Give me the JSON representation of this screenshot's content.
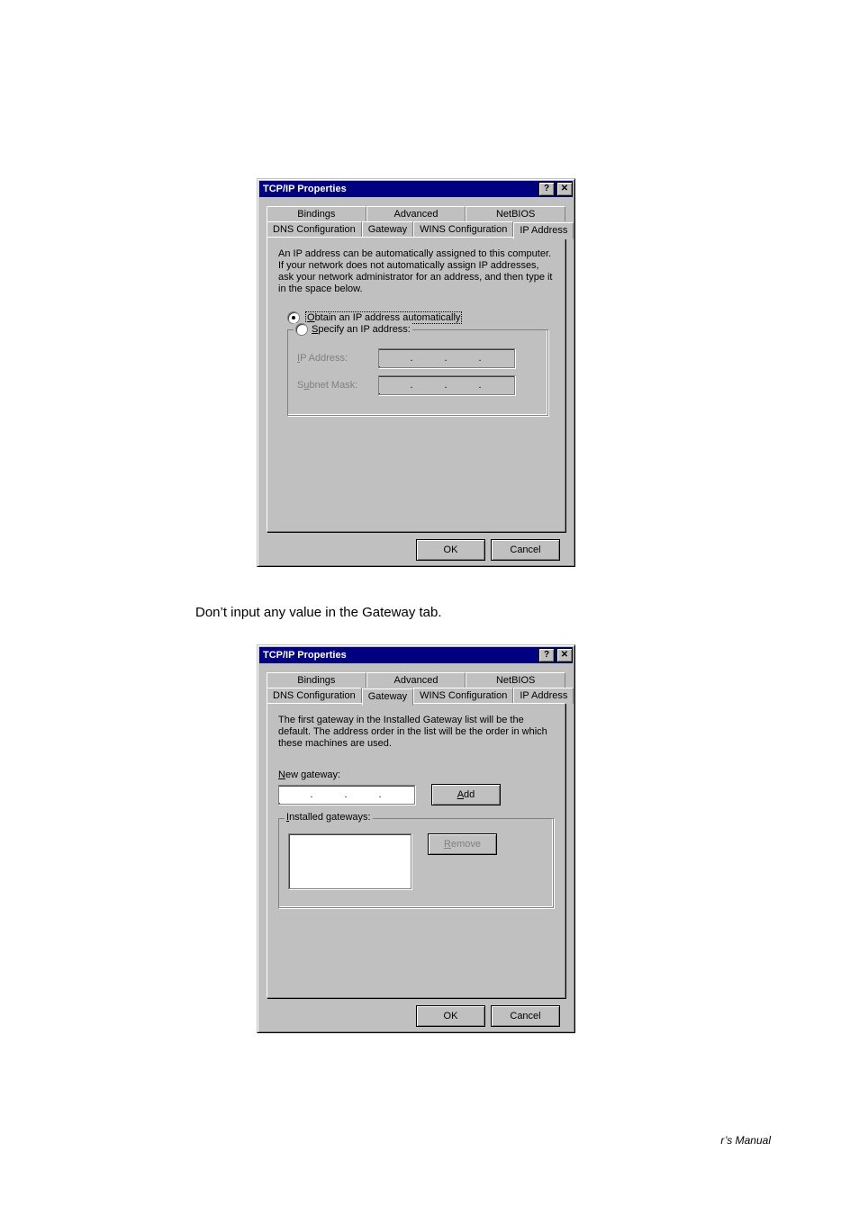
{
  "dialog1": {
    "title": "TCP/IP Properties",
    "tabs_row1": [
      "Bindings",
      "Advanced",
      "NetBIOS"
    ],
    "tabs_row2": [
      "DNS Configuration",
      "Gateway",
      "WINS Configuration",
      "IP Address"
    ],
    "active_tab": "IP Address",
    "description": "An IP address can be automatically assigned to this computer. If your network does not automatically assign IP addresses, ask your network administrator for an address, and then type it in the space below.",
    "radio_obtain": "Obtain an IP address automatically",
    "radio_specify": "Specify an IP address:",
    "label_ip": "IP Address:",
    "label_subnet": "Subnet Mask:",
    "ok": "OK",
    "cancel": "Cancel"
  },
  "instruction": "Don’t input any value in the Gateway tab.",
  "dialog2": {
    "title": "TCP/IP Properties",
    "tabs_row1": [
      "Bindings",
      "Advanced",
      "NetBIOS"
    ],
    "tabs_row2": [
      "DNS Configuration",
      "Gateway",
      "WINS Configuration",
      "IP Address"
    ],
    "active_tab": "Gateway",
    "description": "The first gateway in the Installed Gateway list will be the default. The address order in the list will be the order in which these machines are used.",
    "label_newgw": "New gateway:",
    "btn_add": "Add",
    "group_installed": "Installed gateways:",
    "btn_remove": "Remove",
    "ok": "OK",
    "cancel": "Cancel"
  },
  "footer": "r’s Manual"
}
